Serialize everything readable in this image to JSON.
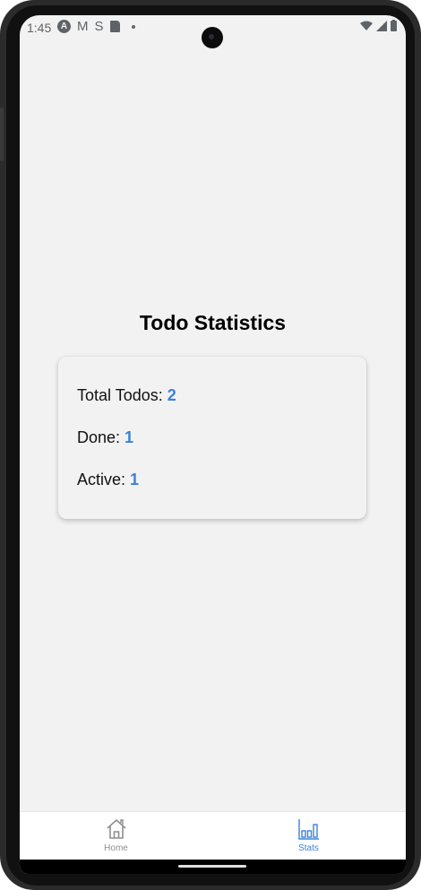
{
  "status_bar": {
    "time": "1:45"
  },
  "screen": {
    "title": "Todo Statistics"
  },
  "stats": {
    "total_label": "Total Todos: ",
    "total_value": "2",
    "done_label": "Done: ",
    "done_value": "1",
    "active_label": "Active: ",
    "active_value": "1"
  },
  "tabs": [
    {
      "label": "Home",
      "icon": "home-icon",
      "active": false
    },
    {
      "label": "Stats",
      "icon": "bar-chart-icon",
      "active": true
    }
  ],
  "colors": {
    "accent": "#3b82d8",
    "background": "#f2f2f2",
    "inactive_tab": "#8e8e8e"
  }
}
